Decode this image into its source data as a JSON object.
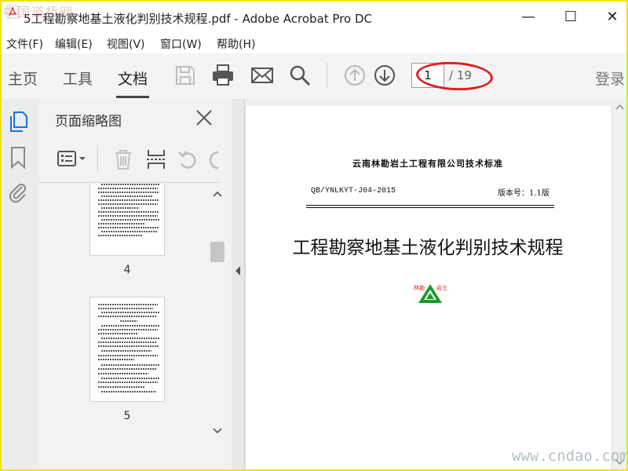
{
  "watermark_top": "中国道桥网",
  "watermark_bottom": "www.cndao.com",
  "window": {
    "title": "5工程勘察地基土液化判别技术规程.pdf - Adobe Acrobat Pro DC",
    "minimize": "—",
    "maximize": "☐",
    "close": "✕"
  },
  "menu": [
    "文件(F)",
    "编辑(E)",
    "视图(V)",
    "窗口(W)",
    "帮助(H)"
  ],
  "tabs": {
    "home": "主页",
    "tools": "工具",
    "document": "文档"
  },
  "toolbar": {
    "icons": [
      "save-icon",
      "print-icon",
      "email-icon",
      "search-icon",
      "prev-page-icon",
      "next-page-icon"
    ],
    "current_page": "1",
    "total_pages": "/ 19",
    "login": "登录"
  },
  "panel": {
    "title": "页面缩略图",
    "thumbnails": [
      {
        "page_label": "4"
      },
      {
        "page_label": "5"
      }
    ]
  },
  "document": {
    "company": "云南林勘岩土工程有限公司技术标准",
    "code": "QB/YNLKYT-J04-2015",
    "version": "版本号：1.1版",
    "title": "工程勘察地基土液化判别技术规程",
    "logo_left": "林勘",
    "logo_right": "岩土"
  },
  "colors": {
    "accent_red": "#e02020",
    "logo_green": "#1a9a2a",
    "frame_yellow": "#f0e400"
  }
}
